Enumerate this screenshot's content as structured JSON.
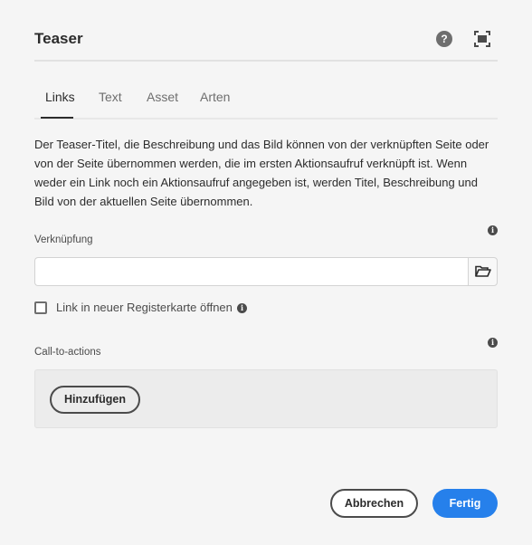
{
  "dialog": {
    "title": "Teaser",
    "help_icon": "help-icon",
    "fullscreen_icon": "fullscreen-icon"
  },
  "tabs": [
    {
      "label": "Links",
      "active": true
    },
    {
      "label": "Text",
      "active": false
    },
    {
      "label": "Asset",
      "active": false
    },
    {
      "label": "Arten",
      "active": false
    }
  ],
  "description": "Der Teaser-Titel, die Beschreibung und das Bild können von der verknüpften Seite oder von der Seite übernommen werden, die im ersten Aktionsaufruf verknüpft ist. Wenn weder ein Link noch ein Aktionsaufruf angegeben ist, werden Titel, Beschreibung und Bild von der aktuellen Seite übernommen.",
  "link_field": {
    "label": "Verknüpfung",
    "value": "",
    "placeholder": "",
    "browse_icon": "folder-open-icon"
  },
  "new_tab_checkbox": {
    "label": "Link in neuer Registerkarte öffnen",
    "checked": false
  },
  "cta": {
    "label": "Call-to-actions",
    "add_label": "Hinzufügen"
  },
  "footer": {
    "cancel_label": "Abbrechen",
    "done_label": "Fertig"
  },
  "colors": {
    "accent": "#2680eb",
    "background": "#f5f5f5"
  }
}
